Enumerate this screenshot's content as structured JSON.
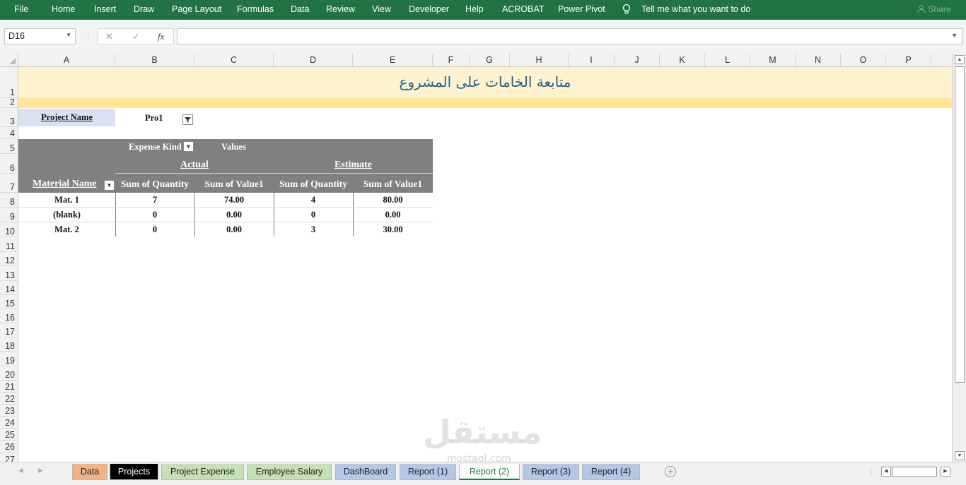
{
  "ribbon": {
    "tabs": [
      "File",
      "Home",
      "Insert",
      "Draw",
      "Page Layout",
      "Formulas",
      "Data",
      "Review",
      "View",
      "Developer",
      "Help",
      "ACROBAT",
      "Power Pivot"
    ],
    "tell_me": "Tell me what you want to do",
    "share": "Share"
  },
  "formula_bar": {
    "name_box": "D16",
    "cancel": "✕",
    "enter": "✓",
    "fx": "fx",
    "value": ""
  },
  "columns": [
    "A",
    "B",
    "C",
    "D",
    "E",
    "F",
    "G",
    "H",
    "I",
    "J",
    "K",
    "L",
    "M",
    "N",
    "O",
    "P"
  ],
  "rows": [
    "1",
    "2",
    "3",
    "4",
    "5",
    "6",
    "7",
    "8",
    "9",
    "10",
    "11",
    "12",
    "13",
    "14",
    "15",
    "16",
    "17",
    "18",
    "19",
    "20",
    "21",
    "22",
    "23",
    "24",
    "25",
    "26",
    "27"
  ],
  "sheet": {
    "title": "متابعة الخامات على المشروع",
    "project_label": "Project Name",
    "project_value": "Pro1"
  },
  "pivot": {
    "expense_kind_label": "Expense Kind",
    "values_label": "Values",
    "groups": [
      "Actual",
      "Estimate"
    ],
    "row_label": "Material Name",
    "value_headers": [
      "Sum of Quantity",
      "Sum of Value1",
      "Sum of Quantity",
      "Sum of Value1"
    ],
    "rows": [
      {
        "name": "Mat. 1",
        "actual_qty": "7",
        "actual_val": "74.00",
        "est_qty": "4",
        "est_val": "80.00"
      },
      {
        "name": "(blank)",
        "actual_qty": "0",
        "actual_val": "0.00",
        "est_qty": "0",
        "est_val": "0.00"
      },
      {
        "name": "Mat. 2",
        "actual_qty": "0",
        "actual_val": "0.00",
        "est_qty": "3",
        "est_val": "30.00"
      }
    ]
  },
  "sheet_tabs": [
    {
      "label": "Data",
      "color": "#f4b183"
    },
    {
      "label": "Projects",
      "color": "#000000"
    },
    {
      "label": "Project Expense",
      "color": "#c5e0b4"
    },
    {
      "label": "Employee Salary",
      "color": "#c5e0b4"
    },
    {
      "label": "DashBoard",
      "color": "#b4c7e7"
    },
    {
      "label": "Report (1)",
      "color": "#b4c7e7"
    },
    {
      "label": "Report (2)",
      "color": "#ffffff",
      "active": true
    },
    {
      "label": "Report (3)",
      "color": "#b4c7e7"
    },
    {
      "label": "Report (4)",
      "color": "#b4c7e7"
    }
  ],
  "watermark": {
    "main": "مستقل",
    "sub": "mostaql.com"
  }
}
